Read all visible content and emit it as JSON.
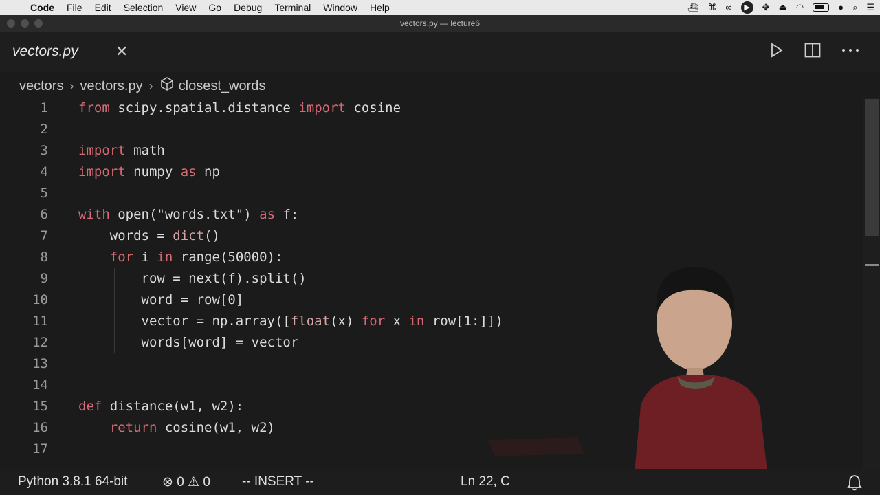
{
  "menubar": {
    "app": "Code",
    "items": [
      "File",
      "Edit",
      "Selection",
      "View",
      "Go",
      "Debug",
      "Terminal",
      "Window",
      "Help"
    ]
  },
  "window": {
    "title": "vectors.py — lecture6"
  },
  "tab": {
    "label": "vectors.py",
    "close": "✕"
  },
  "breadcrumbs": {
    "folder": "vectors",
    "file": "vectors.py",
    "symbol": "closest_words"
  },
  "editor": {
    "lines": [
      {
        "n": "1"
      },
      {
        "n": "2"
      },
      {
        "n": "3"
      },
      {
        "n": "4"
      },
      {
        "n": "5"
      },
      {
        "n": "6"
      },
      {
        "n": "7"
      },
      {
        "n": "8"
      },
      {
        "n": "9"
      },
      {
        "n": "10"
      },
      {
        "n": "11"
      },
      {
        "n": "12"
      },
      {
        "n": "13"
      },
      {
        "n": "14"
      },
      {
        "n": "15"
      },
      {
        "n": "16"
      },
      {
        "n": "17"
      }
    ]
  },
  "status": {
    "interpreter": "Python 3.8.1 64-bit",
    "errors": "0",
    "warnings": "0",
    "mode": "-- INSERT --",
    "position": "Ln 22, C"
  },
  "colors": {
    "keyword": "#d56a74",
    "background": "#1e1e1e",
    "menubar": "#e9e9e9",
    "sweater": "#6e1f24"
  },
  "icons": {
    "tab_actions": [
      "run-icon",
      "split-editor-icon",
      "more-icon"
    ],
    "symbol": "cube-icon",
    "status": [
      "error-icon",
      "warning-icon",
      "bell-icon"
    ]
  }
}
